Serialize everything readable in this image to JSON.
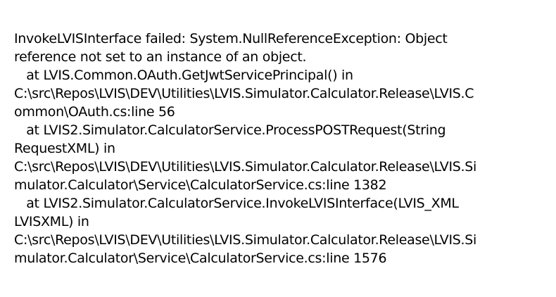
{
  "error": {
    "lines": [
      "InvokeLVISInterface failed: System.NullReferenceException: Object",
      "reference not set to an instance of an object.",
      "   at LVIS.Common.OAuth.GetJwtServicePrincipal() in",
      "C:\\src\\Repos\\LVIS\\DEV\\Utilities\\LVIS.Simulator.Calculator.Release\\LVIS.C",
      "ommon\\OAuth.cs:line 56",
      "   at LVIS2.Simulator.CalculatorService.ProcessPOSTRequest(String",
      "RequestXML) in",
      "C:\\src\\Repos\\LVIS\\DEV\\Utilities\\LVIS.Simulator.Calculator.Release\\LVIS.Si",
      "mulator.Calculator\\Service\\CalculatorService.cs:line 1382",
      "   at LVIS2.Simulator.CalculatorService.InvokeLVISInterface(LVIS_XML",
      "LVISXML) in",
      "C:\\src\\Repos\\LVIS\\DEV\\Utilities\\LVIS.Simulator.Calculator.Release\\LVIS.Si",
      "mulator.Calculator\\Service\\CalculatorService.cs:line 1576"
    ]
  }
}
